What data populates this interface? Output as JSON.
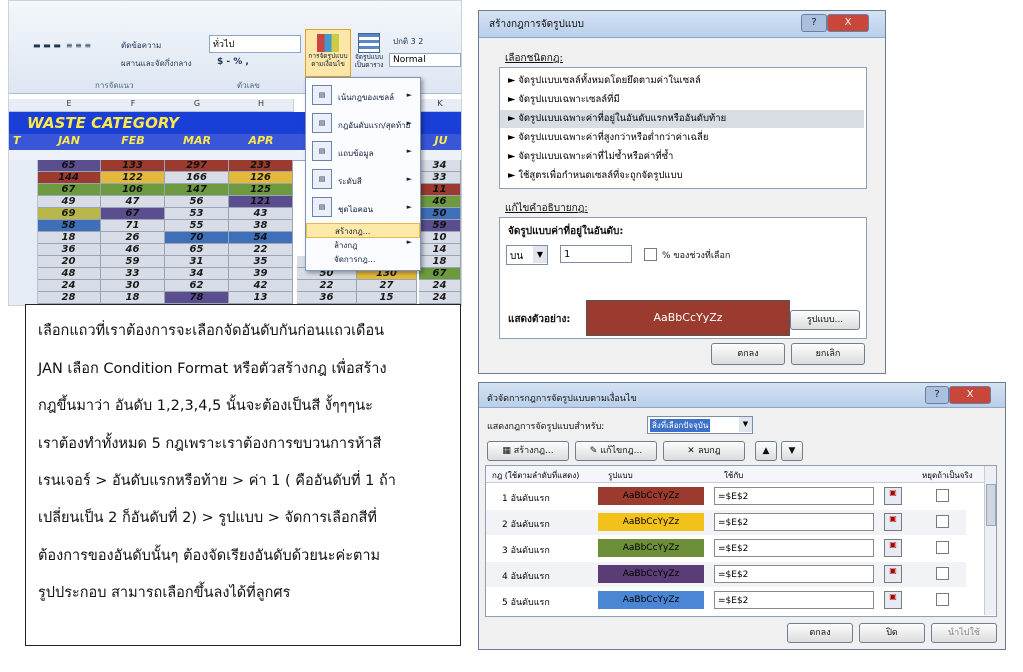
{
  "excel": {
    "ribbon": {
      "cut_label": "ตัดข้อความ",
      "merge_label": "ผสานและจัดกึ่งกลาง",
      "number_format": "ทั่วไป",
      "currency": "$ - % ,",
      "cond_format_label": "การจัดรูปแบบ ตามเงื่อนไข",
      "format_table_label": "จัดรูปแบบ เป็นตาราง",
      "style_normal_top": "ปกติ 3 2",
      "style_normal": "Normal",
      "group_alignment": "การจัดแนว",
      "group_number": "ตัวเลข"
    },
    "columns": [
      "E",
      "F",
      "G",
      "H",
      "K"
    ],
    "title": "WASTE CATEGORY",
    "headers": [
      "JAN",
      "FEB",
      "MAR",
      "APR",
      "JU"
    ],
    "rows": [
      {
        "cells": [
          "65",
          "133",
          "297",
          "233",
          "34"
        ],
        "colors": [
          "#5a4e8f",
          "#9b3a2e",
          "#9b3a2e",
          "#9b3a2e",
          "#d7dce6"
        ]
      },
      {
        "cells": [
          "144",
          "122",
          "166",
          "126",
          "33"
        ],
        "colors": [
          "#9b3a2e",
          "#e2b93b",
          "#d7dce6",
          "#e2b93b",
          "#d7dce6"
        ]
      },
      {
        "cells": [
          "67",
          "106",
          "147",
          "125",
          "11"
        ],
        "colors": [
          "#6d9a3f",
          "#6d9a3f",
          "#6d9a3f",
          "#6d9a3f",
          "#9b3a2e"
        ]
      },
      {
        "cells": [
          "49",
          "47",
          "56",
          "121",
          "46"
        ],
        "colors": [
          "#d7dce6",
          "#d7dce6",
          "#d7dce6",
          "#5a4e8f",
          "#6d9a3f"
        ]
      },
      {
        "cells": [
          "69",
          "67",
          "53",
          "43",
          "50"
        ],
        "colors": [
          "#b8b84a",
          "#5a4e8f",
          "#d7dce6",
          "#d7dce6",
          "#3f6fb8"
        ]
      },
      {
        "cells": [
          "58",
          "71",
          "55",
          "38",
          "59"
        ],
        "colors": [
          "#3f6fb8",
          "#d7dce6",
          "#d7dce6",
          "#d7dce6",
          "#5a4e8f"
        ]
      },
      {
        "cells": [
          "18",
          "26",
          "70",
          "54",
          "10"
        ],
        "colors": [
          "#d7dce6",
          "#d7dce6",
          "#3f6fb8",
          "#3f6fb8",
          "#d7dce6"
        ]
      },
      {
        "cells": [
          "36",
          "46",
          "65",
          "22",
          "14"
        ],
        "colors": [
          "#d7dce6",
          "#d7dce6",
          "#d7dce6",
          "#d7dce6",
          "#d7dce6"
        ]
      },
      {
        "cells": [
          "20",
          "59",
          "31",
          "35",
          "18"
        ],
        "colors": [
          "#d7dce6",
          "#d7dce6",
          "#d7dce6",
          "#d7dce6",
          "#d7dce6"
        ]
      },
      {
        "cells": [
          "48",
          "33",
          "34",
          "39",
          "67"
        ],
        "colors": [
          "#d7dce6",
          "#d7dce6",
          "#d7dce6",
          "#d7dce6",
          "#6d9a3f"
        ]
      },
      {
        "cells": [
          "24",
          "30",
          "62",
          "42",
          "24"
        ],
        "colors": [
          "#d7dce6",
          "#d7dce6",
          "#d7dce6",
          "#d7dce6",
          "#d7dce6"
        ]
      },
      {
        "cells": [
          "28",
          "18",
          "78",
          "13",
          "24"
        ],
        "colors": [
          "#d7dce6",
          "#d7dce6",
          "#5a4e8f",
          "#d7dce6",
          "#d7dce6"
        ]
      }
    ],
    "extra_cells": {
      "r9c1": "69",
      "r9c2": "64",
      "r10c1": "50",
      "r10c2": "130",
      "r11c1": "22",
      "r11c2": "27",
      "r12c1": "36",
      "r12c2": "15"
    },
    "menu": {
      "items": [
        {
          "label": "เน้นกฎของเซลล์",
          "icon": "highlight-rules-icon"
        },
        {
          "label": "กฎอันดับแรก/สุดท้าย",
          "icon": "top-bottom-icon"
        },
        {
          "label": "แถบข้อมูล",
          "icon": "data-bars-icon"
        },
        {
          "label": "ระดับสี",
          "icon": "color-scales-icon"
        },
        {
          "label": "ชุดไอคอน",
          "icon": "icon-sets-icon"
        }
      ],
      "sub": [
        "สร้างกฎ...",
        "ล้างกฎ",
        "จัดการกฎ..."
      ]
    }
  },
  "note": {
    "lines": [
      "เลือกแถวที่เราต้องการจะเลือกจัดอันดับกันก่อนแถวเดือน",
      "JAN เลือก Condition Format หรือตัวสร้างกฎ เพื่อสร้าง",
      "กฎขึ้นมาว่า อันดับ 1,2,3,4,5 นั้นจะต้องเป็นสี งั้ๆๆๆนะ",
      "เราต้องทำทั้งหมด 5 กฎเพราะเราต้องการขบวนการห้าสี",
      "เรนเจอร์ > อันดับแรกหรือท้าย > ค่า 1 ( คืออันดับที่ 1 ถ้า",
      "เปลี่ยนเป็น 2 ก็อันดับที่ 2) > รูปแบบ > จัดการเลือกสีที่",
      "ต้องการของอันดับนั้นๆ  ต้องจัดเรียงอันดับด้วยนะค่ะตาม",
      "รูปประกอบ สามารถเลือกขึ้นลงได้ที่ลูกศร"
    ]
  },
  "new_rule": {
    "title": "สร้างกฎการจัดรูปแบบ",
    "select_type_label": "เลือกชนิดกฎ:",
    "types": [
      "► จัดรูปแบบเซลล์ทั้งหมดโดยยึดตามค่าในเซลล์",
      "► จัดรูปแบบเฉพาะเซลล์ที่มี",
      "► จัดรูปแบบเฉพาะค่าที่อยู่ในอันดับแรกหรืออันดับท้าย",
      "► จัดรูปแบบเฉพาะค่าที่สูงกว่าหรือต่ำกว่าค่าเฉลี่ย",
      "► จัดรูปแบบเฉพาะค่าที่ไม่ซ้ำหรือค่าที่ซ้ำ",
      "► ใช้สูตรเพื่อกำหนดเซลล์ที่จะถูกจัดรูปแบบ"
    ],
    "edit_desc_label": "แก้ไขคำอธิบายกฎ:",
    "format_values_label": "จัดรูปแบบค่าที่อยู่ในอันดับ:",
    "rank_select": "บน",
    "rank_value": "1",
    "percent_label": "% ของช่วงที่เลือก",
    "preview_label": "แสดงตัวอย่าง:",
    "preview_text": "AaBbCcYyZz",
    "format_button": "รูปแบบ...",
    "ok": "ตกลง",
    "cancel": "ยกเลิก",
    "help": "?",
    "close": "X"
  },
  "manager": {
    "title": "ตัวจัดการกฎการจัดรูปแบบตามเงื่อนไข",
    "show_for_label": "แสดงกฎการจัดรูปแบบสำหรับ:",
    "show_for_value": "สิ่งที่เลือกปัจจุบัน",
    "new_rule": "สร้างกฎ...",
    "edit_rule": "แก้ไขกฎ...",
    "delete_rule": "ลบกฎ",
    "col_rule": "กฎ (ใช้ตามลำดับที่แสดง)",
    "col_format": "รูปแบบ",
    "col_applies": "ใช้กับ",
    "col_stop": "หยุดถ้าเป็นจริง",
    "rules": [
      {
        "name": "1 อันดับแรก",
        "sample": "AaBbCcYyZz",
        "applies": "=$E$2",
        "color": "#9b3a2e"
      },
      {
        "name": "2 อันดับแรก",
        "sample": "AaBbCcYyZz",
        "applies": "=$E$2",
        "color": "#f2c21b"
      },
      {
        "name": "3 อันดับแรก",
        "sample": "AaBbCcYyZz",
        "applies": "=$E$2",
        "color": "#6d8f3a"
      },
      {
        "name": "4 อันดับแรก",
        "sample": "AaBbCcYyZz",
        "applies": "=$E$2",
        "color": "#5a3d75"
      },
      {
        "name": "5 อันดับแรก",
        "sample": "AaBbCcYyZz",
        "applies": "=$E$2",
        "color": "#4a86d4"
      }
    ],
    "ok": "ตกลง",
    "close_btn": "ปิด",
    "apply": "นำไปใช้",
    "help": "?",
    "close": "X"
  }
}
